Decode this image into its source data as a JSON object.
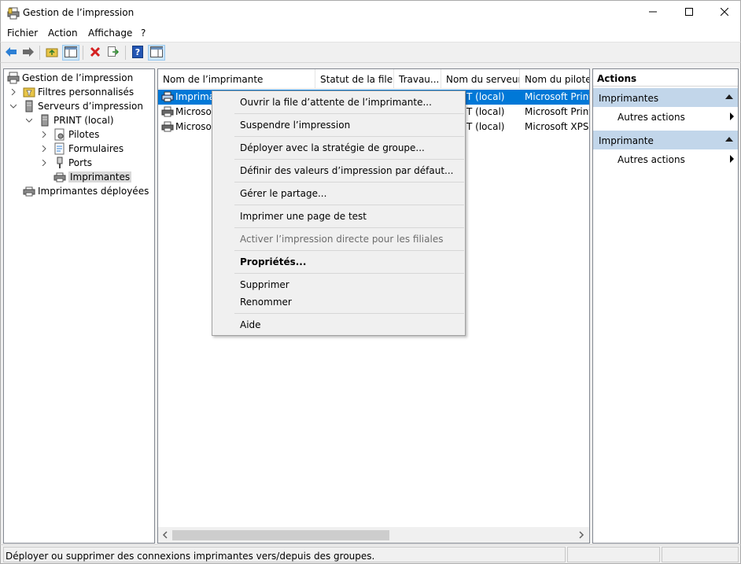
{
  "window": {
    "title": "Gestion de l’impression",
    "controls": {
      "minimize": "minimize-icon",
      "maximize": "maximize-icon",
      "close": "close-icon"
    }
  },
  "menu": [
    "Fichier",
    "Action",
    "Affichage",
    "?"
  ],
  "toolbar": {
    "buttons": [
      "back-arrow-icon",
      "forward-arrow-icon",
      "folder-up-icon",
      "show-hide-console-tree-icon",
      "delete-icon",
      "export-list-icon",
      "help-icon",
      "show-hide-action-pane-icon"
    ]
  },
  "tree": {
    "root": "Gestion de l’impression",
    "custom_filters": "Filtres personnalisés",
    "print_servers": "Serveurs d’impression",
    "server": "PRINT (local)",
    "drivers": "Pilotes",
    "forms": "Formulaires",
    "ports": "Ports",
    "printers": "Imprimantes",
    "deployed": "Imprimantes déployées"
  },
  "list": {
    "columns": [
      "Nom de l’imprimante",
      "Statut de la file...",
      "Travau...",
      "Nom du serveur",
      "Nom du pilote"
    ],
    "rows": [
      {
        "name": "Imprima",
        "server": "T (local)",
        "driver": "Microsoft Print"
      },
      {
        "name": "Microsof",
        "server": "T (local)",
        "driver": "Microsoft Print"
      },
      {
        "name": "Microsof",
        "server": "T (local)",
        "driver": "Microsoft XPS D"
      }
    ]
  },
  "actions": {
    "title": "Actions",
    "section1": "Imprimantes",
    "section1_item": "Autres actions",
    "section2": "Imprimante",
    "section2_item": "Autres actions"
  },
  "context_menu": {
    "open_queue": "Ouvrir la file d’attente de l’imprimante...",
    "pause": "Suspendre l’impression",
    "deploy": "Déployer avec la stratégie de groupe...",
    "defaults": "Définir des valeurs d’impression par défaut...",
    "sharing": "Gérer le partage...",
    "test_page": "Imprimer une page de test",
    "branch_office": "Activer l’impression directe pour les filiales",
    "properties": "Propriétés...",
    "delete": "Supprimer",
    "rename": "Renommer",
    "help": "Aide"
  },
  "status": {
    "text": "Déployer ou supprimer des connexions imprimantes vers/depuis des groupes."
  },
  "colors": {
    "selection": "#0078d7",
    "action_section": "#c2d6ea"
  }
}
